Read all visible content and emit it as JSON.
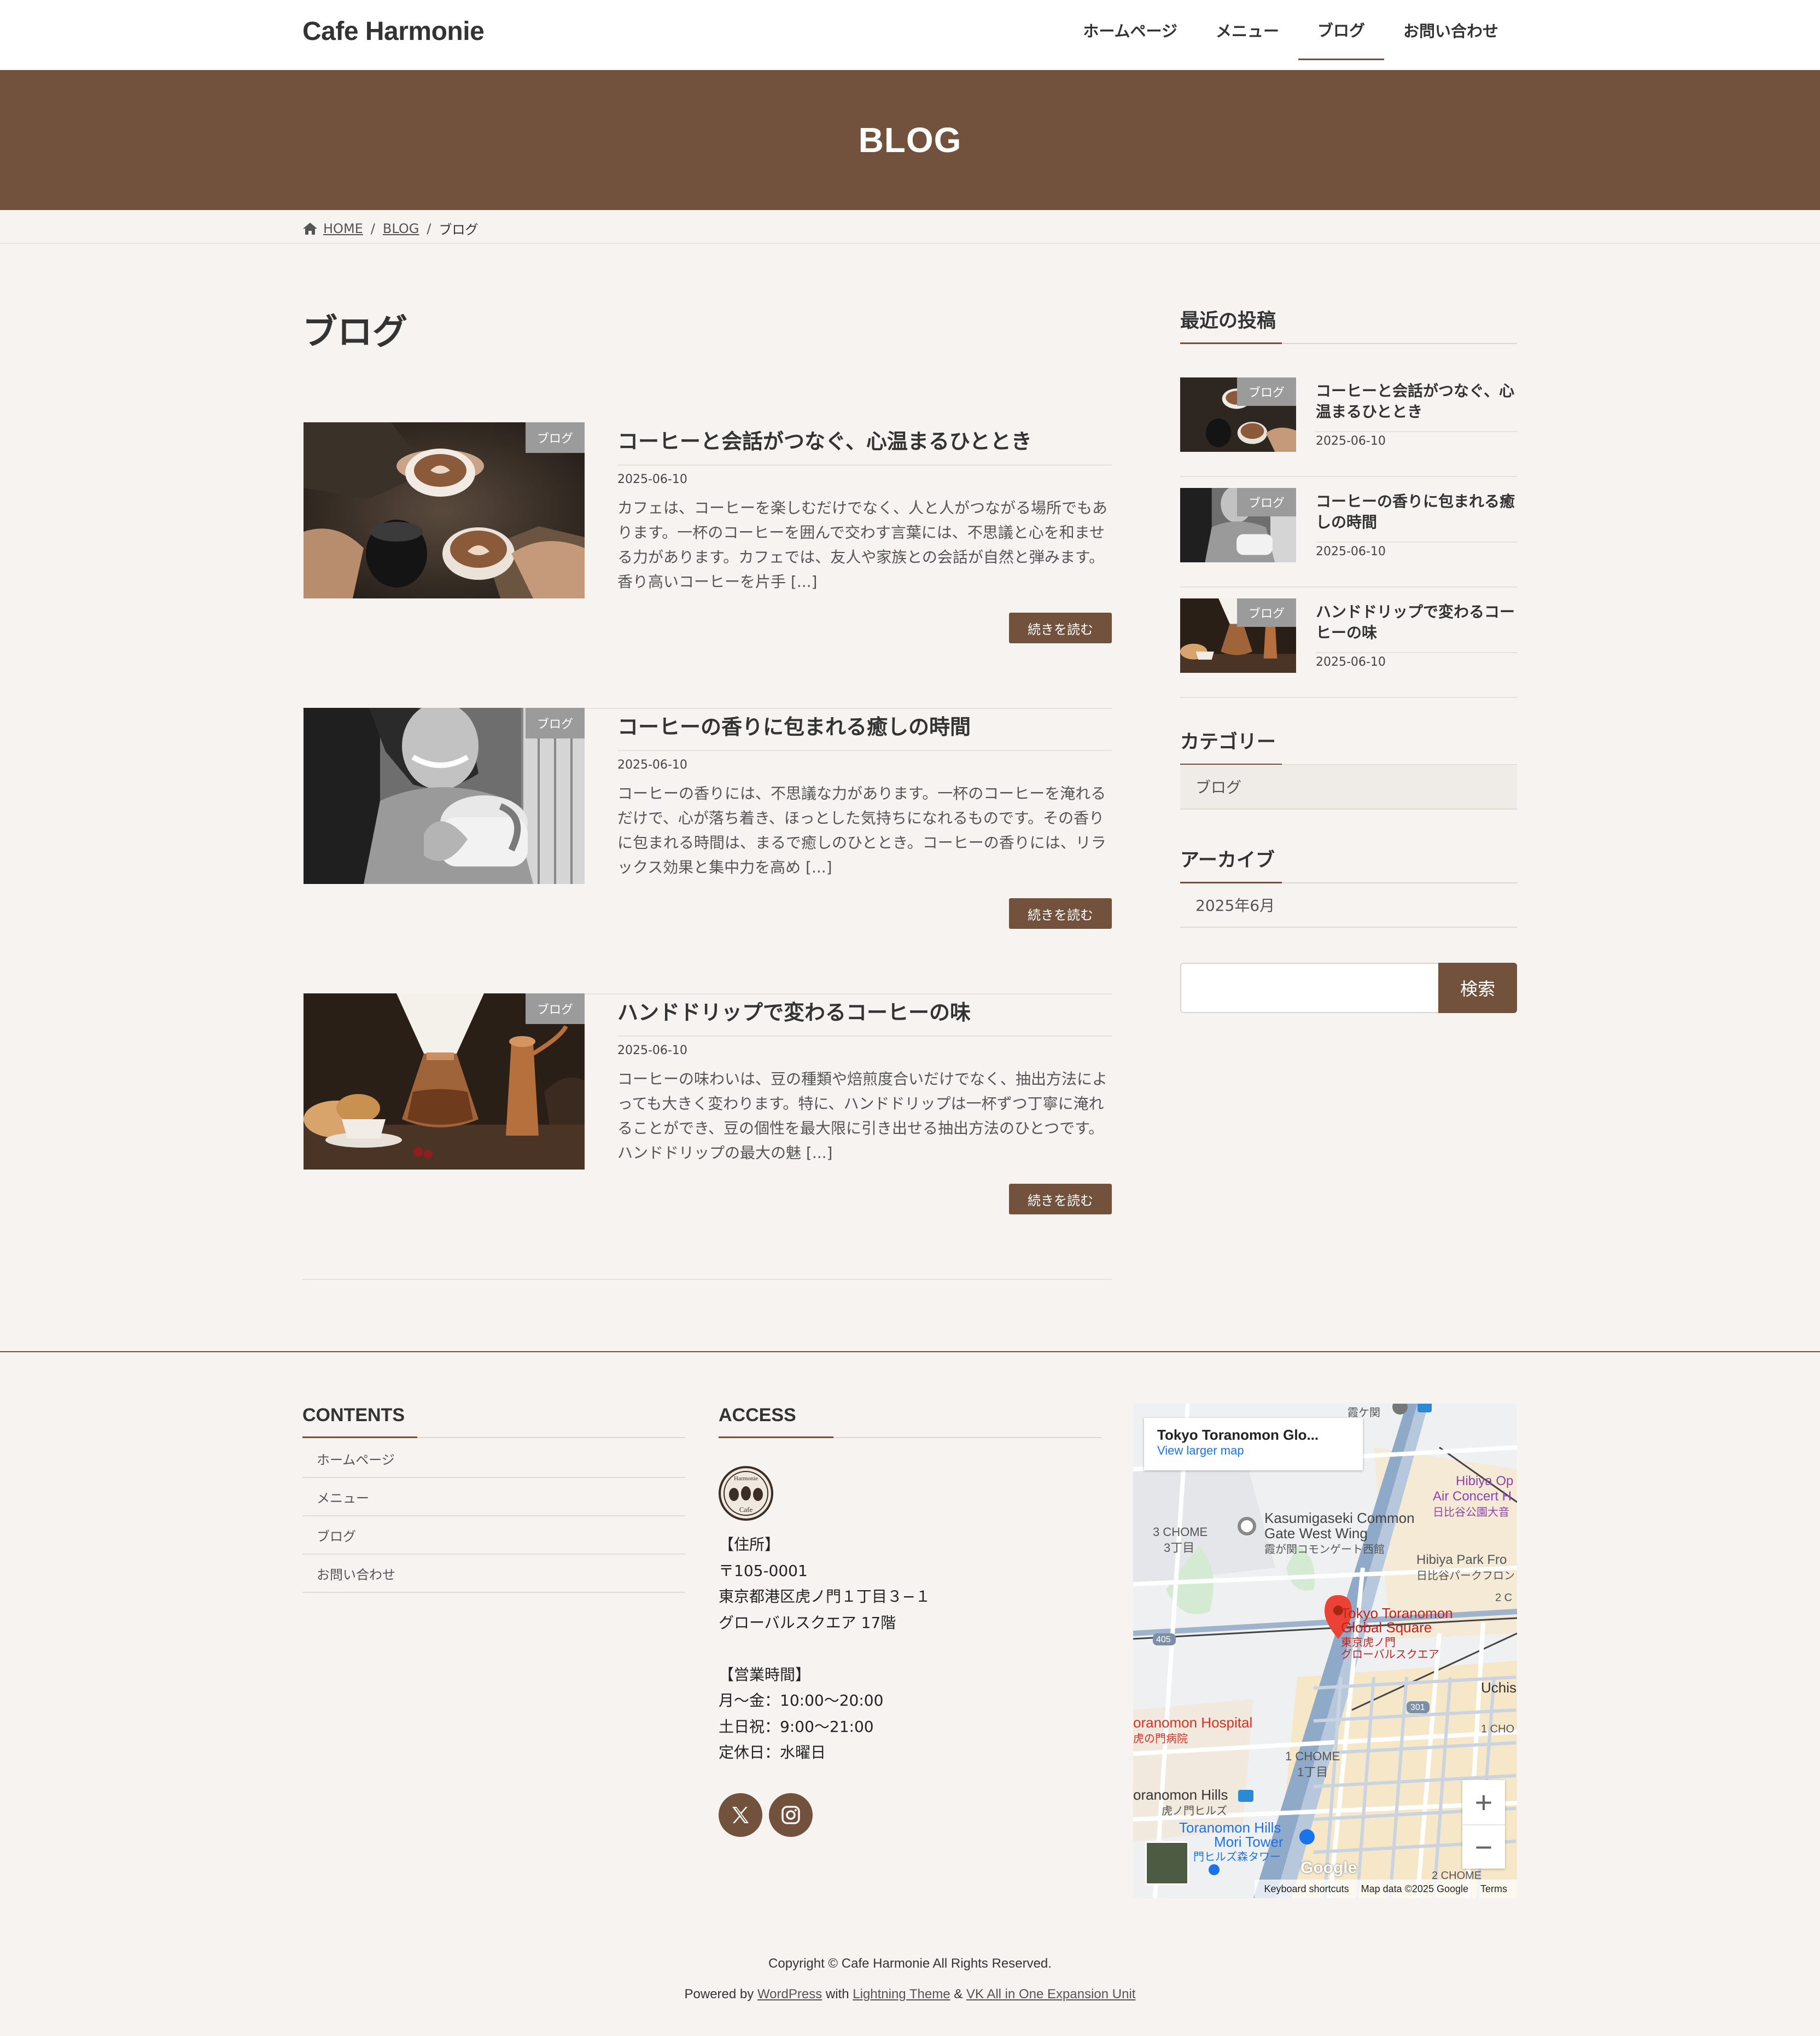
{
  "header": {
    "logo": "Cafe Harmonie",
    "nav": [
      "ホームページ",
      "メニュー",
      "ブログ",
      "お問い合わせ"
    ],
    "current_nav_index": 2
  },
  "page_header": {
    "title": "BLOG"
  },
  "breadcrumb": {
    "home": "HOME",
    "blog": "BLOG",
    "current": "ブログ"
  },
  "main": {
    "title": "ブログ",
    "read_more_label": "続きを読む",
    "posts": [
      {
        "category": "ブログ",
        "title": "コーヒーと会話がつなぐ、心温まるひととき",
        "date": "2025-06-10",
        "excerpt_lines": [
          "カフェは、コーヒーを楽しむだけでなく、人と人がつながる場所でもあ",
          "ります。一杯のコーヒーを囲んで交わす言葉には、不思議と心を和ませ",
          "る力があります。カフェでは、友人や家族との会話が自然と弾みます。",
          "香り高いコーヒーを片手 [...]"
        ]
      },
      {
        "category": "ブログ",
        "title": "コーヒーの香りに包まれる癒しの時間",
        "date": "2025-06-10",
        "excerpt_lines": [
          "コーヒーの香りには、不思議な力があります。一杯のコーヒーを淹れる",
          "だけで、心が落ち着き、ほっとした気持ちになれるものです。その香り",
          "に包まれる時間は、まるで癒しのひととき。コーヒーの香りには、リラ",
          "ックス効果と集中力を高め [...]"
        ]
      },
      {
        "category": "ブログ",
        "title": "ハンドドリップで変わるコーヒーの味",
        "date": "2025-06-10",
        "excerpt_lines": [
          "コーヒーの味わいは、豆の種類や焙煎度合いだけでなく、抽出方法によ",
          "っても大きく変わります。特に、ハンドドリップは一杯ずつ丁寧に淹れ",
          "ることができ、豆の個性を最大限に引き出せる抽出方法のひとつです。",
          "ハンドドリップの最大の魅 [...]"
        ]
      }
    ]
  },
  "sidebar": {
    "recent_title": "最近の投稿",
    "recent": [
      {
        "category": "ブログ",
        "title": "コーヒーと会話がつなぐ、心温まるひととき",
        "date": "2025-06-10"
      },
      {
        "category": "ブログ",
        "title": "コーヒーの香りに包まれる癒しの時間",
        "date": "2025-06-10"
      },
      {
        "category": "ブログ",
        "title": "ハンドドリップで変わるコーヒーの味",
        "date": "2025-06-10"
      }
    ],
    "categories_title": "カテゴリー",
    "categories": [
      "ブログ"
    ],
    "archive_title": "アーカイブ",
    "archives": [
      "2025年6月"
    ],
    "search_value": "",
    "search_button": "検索"
  },
  "footer": {
    "contents_title": "CONTENTS",
    "contents_nav": [
      "ホームページ",
      "メニュー",
      "ブログ",
      "お問い合わせ"
    ],
    "access_title": "ACCESS",
    "logo_text_top": "Harmonie",
    "logo_text_bottom": "Cafe",
    "access_lines": [
      "【住所】",
      "〒105-0001",
      "東京都港区虎ノ門１丁目３−１",
      "グローバルスクエア 17階",
      "",
      "【営業時間】",
      "月〜金：10:00〜20:00",
      "土日祝：9:00〜21:00",
      "定休日：水曜日"
    ],
    "sns": [
      "x-icon",
      "instagram-icon"
    ],
    "map": {
      "place_name": "Tokyo Toranomon Glo...",
      "larger_map": "View larger map",
      "pin_label_en_1": "Tokyo Toranomon",
      "pin_label_en_2": "Global Square",
      "pin_label_ja_1": "東京虎ノ門",
      "pin_label_ja_2": "グローバルスクエア",
      "labels": {
        "kasumigaseki_1": "Kasumigaseki Common",
        "kasumigaseki_2": "Gate West Wing",
        "kasumigaseki_ja": "霞が関コモンゲート西館",
        "chome3_en": "3 CHOME",
        "chome3_ja": "3丁目",
        "hibiya_1": "Hibiya Op",
        "hibiya_2": "Air Concert H",
        "hibiya_ja": "日比谷公園大音",
        "hibiya_park": "Hibiya Park Fro",
        "hibiya_park_ja": "日比谷パークフロン",
        "road_405": "405",
        "road_301": "301",
        "uchis": "Uchis",
        "hospital": "oranomon Hospital",
        "hospital_ja": "虎の門病院",
        "chome1_en": "1 CHOME",
        "chome1_ja": "1丁目",
        "hills": "oranomon Hills",
        "hills_ja": "虎ノ門ヒルズ",
        "mori_1": "Toranomon Hills",
        "mori_2": "Mori Tower",
        "mori_ja": "門ヒルズ森タワー",
        "kasumigaseki_top": "霞ケ関",
        "chome2": "2 C",
        "chome1_r": "1 CHO",
        "chome2_bottom": "2 CHOME"
      },
      "zoom_in": "+",
      "zoom_out": "−",
      "google": "Google",
      "attr_shortcuts": "Keyboard shortcuts",
      "attr_data": "Map data ©2025 Google",
      "attr_terms": "Terms"
    },
    "copyright": "Copyright © Cafe Harmonie All Rights Reserved.",
    "powered_prefix": "Powered by",
    "powered_wp": "WordPress",
    "powered_with": "with",
    "powered_theme": "Lightning Theme",
    "powered_amp": "&",
    "powered_vk": "VK All in One Expansion Unit"
  },
  "colors": {
    "brand": "#72513d",
    "background": "#f6f3f0",
    "badge": "#9b9b9b"
  }
}
